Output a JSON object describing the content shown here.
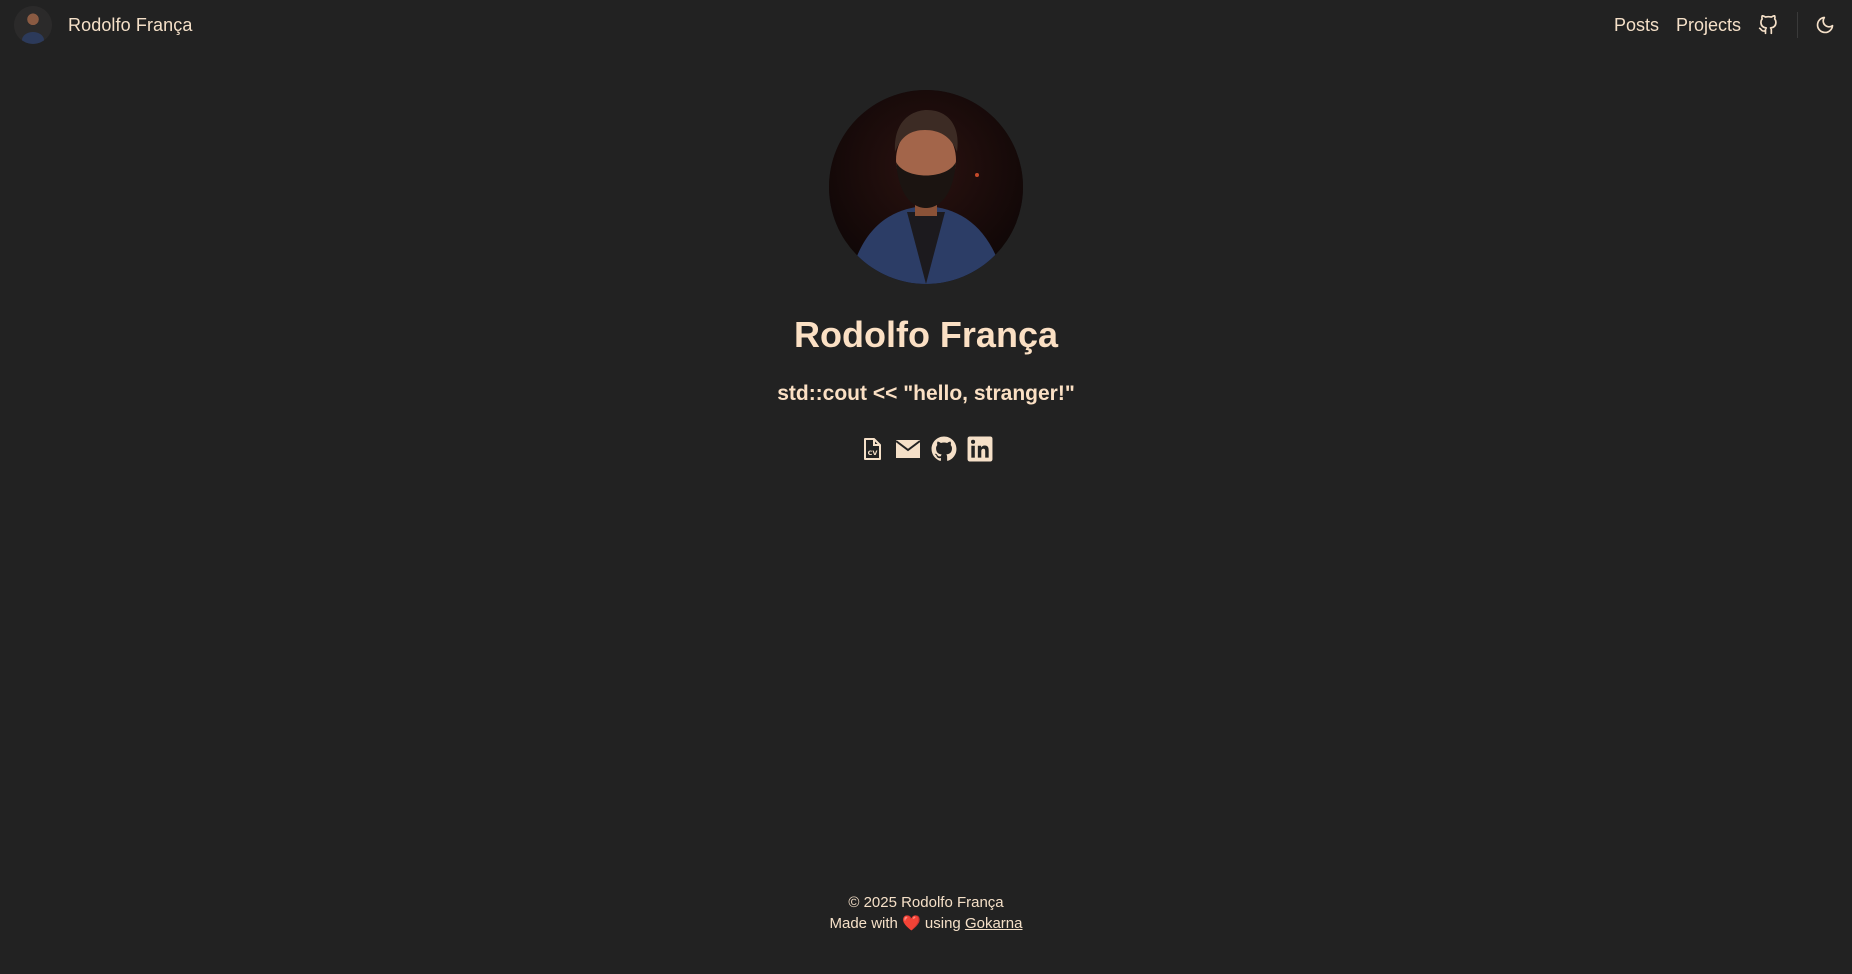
{
  "header": {
    "brand_name": "Rodolfo França",
    "nav": [
      {
        "label": "Posts"
      },
      {
        "label": "Projects"
      }
    ],
    "icons": [
      "github-icon",
      "moon-icon"
    ]
  },
  "hero": {
    "title": "Rodolfo França",
    "subtitle": "std::cout << \"hello, stranger!\"",
    "social_icons": [
      "cv-document-icon",
      "email-icon",
      "github-icon",
      "linkedin-icon"
    ]
  },
  "footer": {
    "copyright": "© 2025 Rodolfo França",
    "made_with": "Made with",
    "heart": "❤️",
    "using": "using",
    "link_text": "Gokarna"
  },
  "colors": {
    "background": "#222222",
    "text": "#f5e0c8",
    "heart": "#e0342b"
  }
}
